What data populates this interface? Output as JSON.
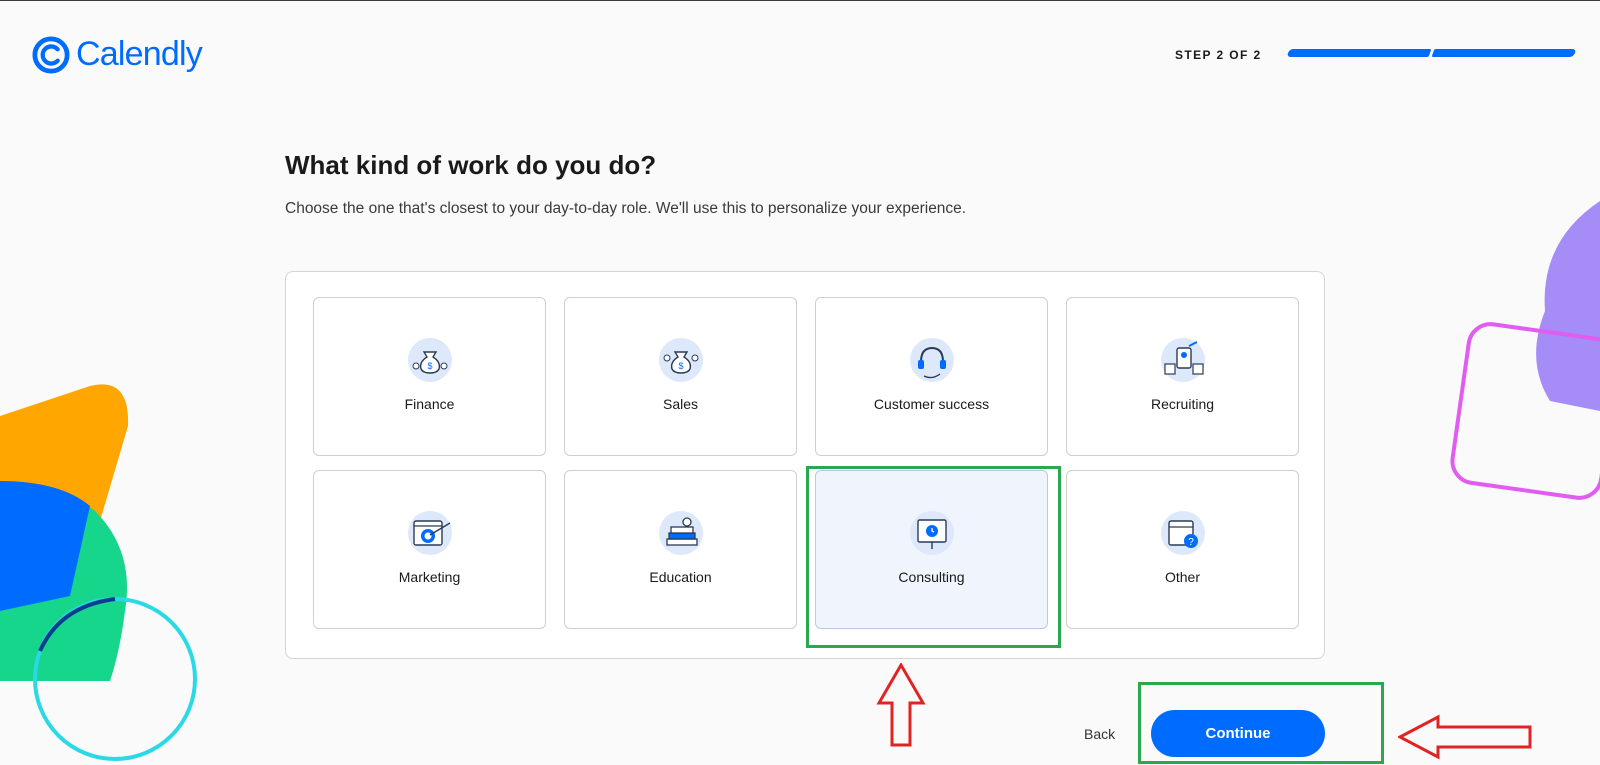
{
  "brand": {
    "name": "Calendly",
    "color": "#006bff"
  },
  "progress": {
    "label": "STEP 2 OF 2",
    "current": 2,
    "total": 2
  },
  "heading": {
    "title": "What kind of work do you do?",
    "subtitle": "Choose the one that's closest to your day-to-day role. We'll use this to personalize your experience."
  },
  "roles": [
    {
      "label": "Finance",
      "icon": "money-bag-icon",
      "selected": false
    },
    {
      "label": "Sales",
      "icon": "money-bag-icon",
      "selected": false
    },
    {
      "label": "Customer success",
      "icon": "headset-icon",
      "selected": false
    },
    {
      "label": "Recruiting",
      "icon": "candidate-profile-icon",
      "selected": false
    },
    {
      "label": "Marketing",
      "icon": "target-browser-icon",
      "selected": false
    },
    {
      "label": "Education",
      "icon": "books-apple-icon",
      "selected": false
    },
    {
      "label": "Consulting",
      "icon": "presentation-board-icon",
      "selected": true
    },
    {
      "label": "Other",
      "icon": "calendar-question-icon",
      "selected": false
    }
  ],
  "footer": {
    "back_label": "Back",
    "continue_label": "Continue"
  },
  "annotations": {
    "highlight_color": "#2aa84f",
    "arrow_color": "#e02424"
  }
}
